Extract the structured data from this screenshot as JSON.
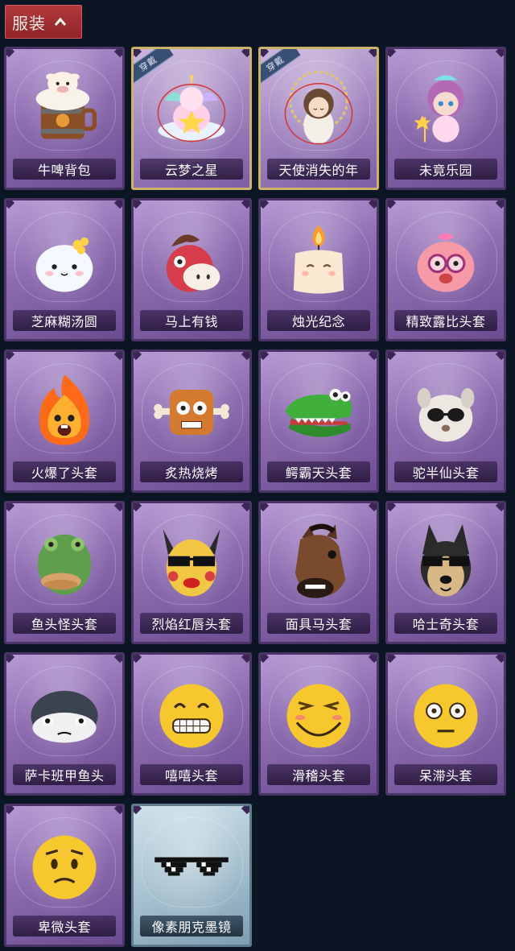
{
  "header": {
    "tab_label": "服装"
  },
  "items": [
    {
      "name": "牛啤背包",
      "icon": "beer-backpack-icon"
    },
    {
      "name": "云梦之星",
      "icon": "unicorn-star-icon",
      "badge": "穿戴"
    },
    {
      "name": "天使消失的年",
      "icon": "angel-doll-icon",
      "badge": "穿戴"
    },
    {
      "name": "未竟乐园",
      "icon": "fairy-girl-icon"
    },
    {
      "name": "芝麻糊汤圆",
      "icon": "rice-ball-icon"
    },
    {
      "name": "马上有钱",
      "icon": "red-horse-icon"
    },
    {
      "name": "烛光纪念",
      "icon": "candle-icon"
    },
    {
      "name": "精致露比头套",
      "icon": "pink-beaver-head-icon"
    },
    {
      "name": "火爆了头套",
      "icon": "fire-head-icon"
    },
    {
      "name": "炙热烧烤",
      "icon": "grill-meat-icon"
    },
    {
      "name": "鳄霸天头套",
      "icon": "crocodile-head-icon"
    },
    {
      "name": "驼半仙头套",
      "icon": "alpaca-head-icon"
    },
    {
      "name": "鱼头怪头套",
      "icon": "fish-head-icon"
    },
    {
      "name": "烈焰红唇头套",
      "icon": "red-lips-head-icon"
    },
    {
      "name": "面具马头套",
      "icon": "horse-mask-icon"
    },
    {
      "name": "哈士奇头套",
      "icon": "husky-head-icon"
    },
    {
      "name": "萨卡班甲鱼头",
      "icon": "sacabambaspis-head-icon"
    },
    {
      "name": "嘻嘻头套",
      "icon": "grin-emoji-head-icon"
    },
    {
      "name": "滑稽头套",
      "icon": "funny-emoji-head-icon"
    },
    {
      "name": "呆滞头套",
      "icon": "stunned-emoji-head-icon"
    },
    {
      "name": "卑微头套",
      "icon": "humble-emoji-head-icon"
    },
    {
      "name": "像素朋克墨镜",
      "icon": "pixel-sunglasses-icon",
      "rarity": "blue"
    }
  ],
  "colors": {
    "background": "#0c1524",
    "tab": "#a8302f",
    "card_purple": "#8d6cb0",
    "card_blue": "#a9c3d1",
    "equipped_border": "#cdb36a"
  }
}
